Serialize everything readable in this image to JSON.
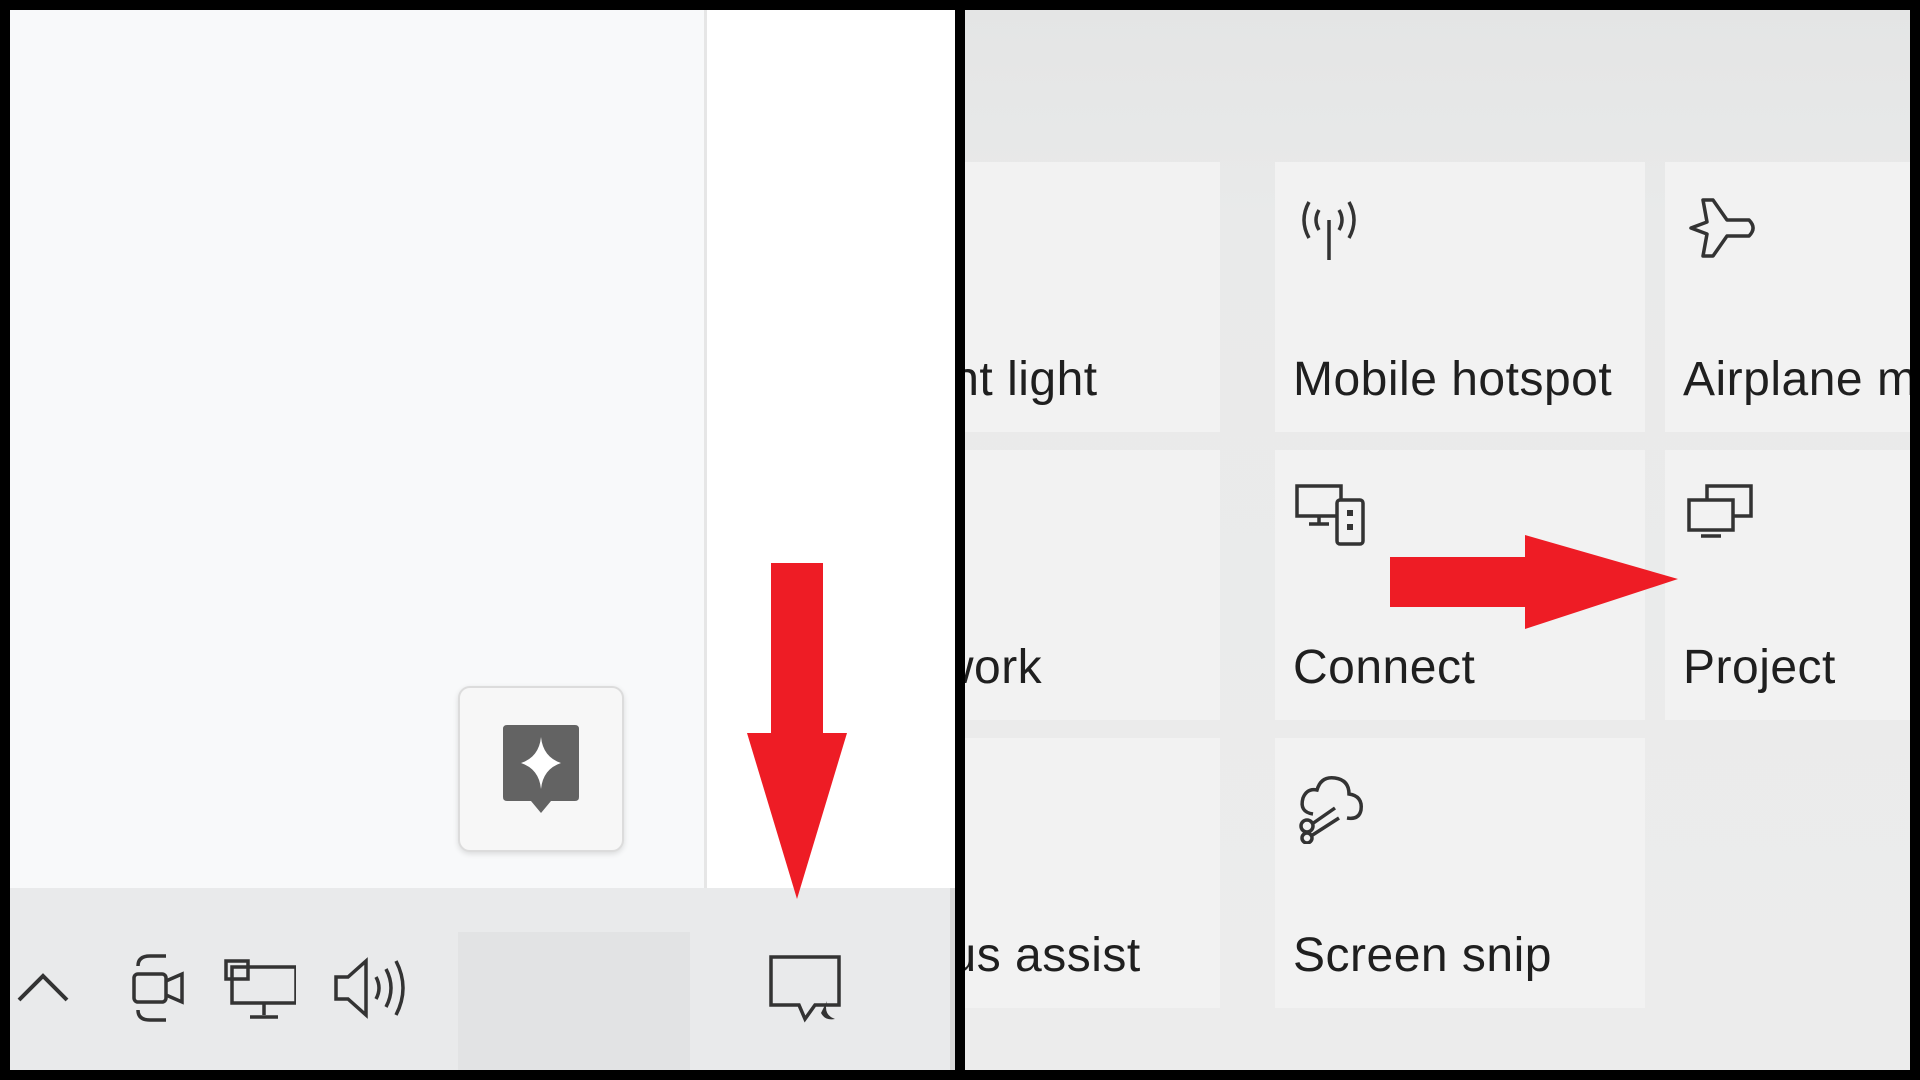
{
  "left_panel": {
    "taskbar": {
      "tray_icons": [
        "chevron-up-icon",
        "camera-icon",
        "network-icon",
        "volume-icon"
      ],
      "notification_icon": "notification-center-icon"
    },
    "floating_button_icon": "copilot-sparkle-icon",
    "annotation": {
      "type": "arrow",
      "direction": "down",
      "color": "#ee1c25"
    }
  },
  "right_panel": {
    "tiles": [
      {
        "label": "ght light",
        "icon": "night-light-icon"
      },
      {
        "label": "Mobile hotspot",
        "icon": "mobile-hotspot-icon"
      },
      {
        "label": "Airplane m",
        "icon": "airplane-icon"
      },
      {
        "label": "twork",
        "icon": "network-icon"
      },
      {
        "label": "Connect",
        "icon": "connect-icon"
      },
      {
        "label": "Project",
        "icon": "project-icon"
      },
      {
        "label": "cus assist",
        "icon": "focus-assist-icon"
      },
      {
        "label": "Screen snip",
        "icon": "screen-snip-icon"
      }
    ],
    "annotation": {
      "type": "arrow",
      "direction": "right",
      "color": "#ee1c25"
    }
  }
}
